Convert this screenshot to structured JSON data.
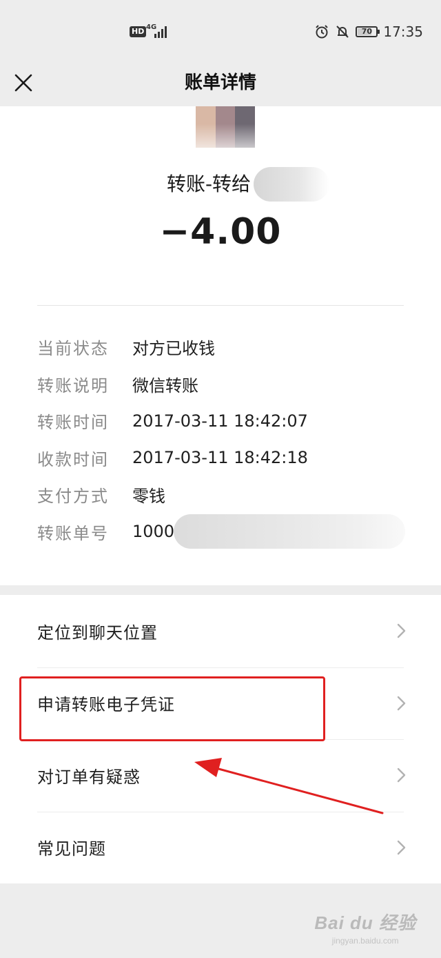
{
  "status_bar": {
    "hd_badge": "HD",
    "network": "4G",
    "battery_level": "70",
    "time": "17:35"
  },
  "nav": {
    "title": "账单详情"
  },
  "transaction": {
    "label": "转账-转给",
    "amount": "−4.00"
  },
  "details": [
    {
      "key": "当前状态",
      "value": "对方已收钱"
    },
    {
      "key": "转账说明",
      "value": "微信转账"
    },
    {
      "key": "转账时间",
      "value": "2017-03-11 18:42:07"
    },
    {
      "key": "收款时间",
      "value": "2017-03-11 18:42:18"
    },
    {
      "key": "支付方式",
      "value": "零钱"
    },
    {
      "key": "转账单号",
      "value": "10000"
    }
  ],
  "menu": [
    {
      "label": "定位到聊天位置"
    },
    {
      "label": "申请转账电子凭证"
    },
    {
      "label": "对订单有疑惑"
    },
    {
      "label": "常见问题"
    }
  ],
  "watermark": {
    "brand": "Bai du 经验",
    "sub": "jingyan.baidu.com"
  },
  "colors": {
    "annotation": "#e02020",
    "background": "#ededed"
  }
}
